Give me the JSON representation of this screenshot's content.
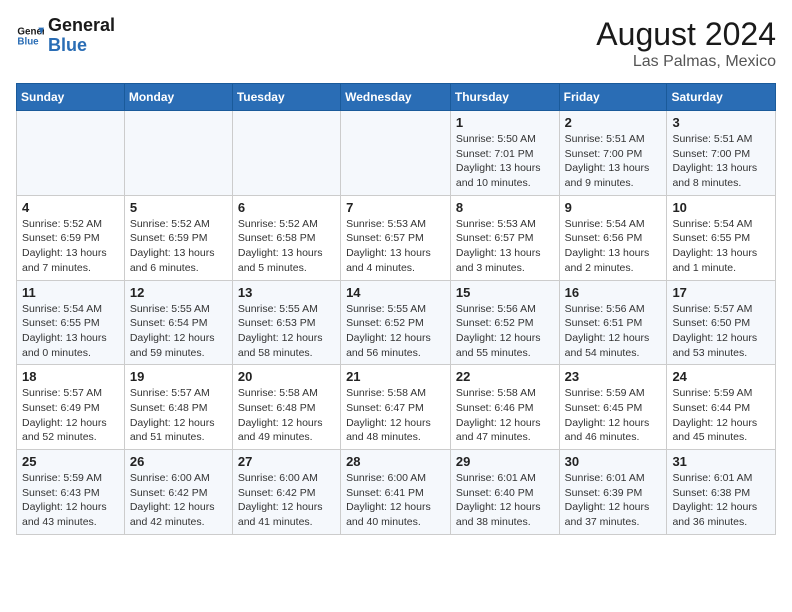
{
  "header": {
    "logo_line1": "General",
    "logo_line2": "Blue",
    "main_title": "August 2024",
    "sub_title": "Las Palmas, Mexico"
  },
  "weekdays": [
    "Sunday",
    "Monday",
    "Tuesday",
    "Wednesday",
    "Thursday",
    "Friday",
    "Saturday"
  ],
  "weeks": [
    [
      {
        "day": "",
        "info": ""
      },
      {
        "day": "",
        "info": ""
      },
      {
        "day": "",
        "info": ""
      },
      {
        "day": "",
        "info": ""
      },
      {
        "day": "1",
        "info": "Sunrise: 5:50 AM\nSunset: 7:01 PM\nDaylight: 13 hours and 10 minutes."
      },
      {
        "day": "2",
        "info": "Sunrise: 5:51 AM\nSunset: 7:00 PM\nDaylight: 13 hours and 9 minutes."
      },
      {
        "day": "3",
        "info": "Sunrise: 5:51 AM\nSunset: 7:00 PM\nDaylight: 13 hours and 8 minutes."
      }
    ],
    [
      {
        "day": "4",
        "info": "Sunrise: 5:52 AM\nSunset: 6:59 PM\nDaylight: 13 hours and 7 minutes."
      },
      {
        "day": "5",
        "info": "Sunrise: 5:52 AM\nSunset: 6:59 PM\nDaylight: 13 hours and 6 minutes."
      },
      {
        "day": "6",
        "info": "Sunrise: 5:52 AM\nSunset: 6:58 PM\nDaylight: 13 hours and 5 minutes."
      },
      {
        "day": "7",
        "info": "Sunrise: 5:53 AM\nSunset: 6:57 PM\nDaylight: 13 hours and 4 minutes."
      },
      {
        "day": "8",
        "info": "Sunrise: 5:53 AM\nSunset: 6:57 PM\nDaylight: 13 hours and 3 minutes."
      },
      {
        "day": "9",
        "info": "Sunrise: 5:54 AM\nSunset: 6:56 PM\nDaylight: 13 hours and 2 minutes."
      },
      {
        "day": "10",
        "info": "Sunrise: 5:54 AM\nSunset: 6:55 PM\nDaylight: 13 hours and 1 minute."
      }
    ],
    [
      {
        "day": "11",
        "info": "Sunrise: 5:54 AM\nSunset: 6:55 PM\nDaylight: 13 hours and 0 minutes."
      },
      {
        "day": "12",
        "info": "Sunrise: 5:55 AM\nSunset: 6:54 PM\nDaylight: 12 hours and 59 minutes."
      },
      {
        "day": "13",
        "info": "Sunrise: 5:55 AM\nSunset: 6:53 PM\nDaylight: 12 hours and 58 minutes."
      },
      {
        "day": "14",
        "info": "Sunrise: 5:55 AM\nSunset: 6:52 PM\nDaylight: 12 hours and 56 minutes."
      },
      {
        "day": "15",
        "info": "Sunrise: 5:56 AM\nSunset: 6:52 PM\nDaylight: 12 hours and 55 minutes."
      },
      {
        "day": "16",
        "info": "Sunrise: 5:56 AM\nSunset: 6:51 PM\nDaylight: 12 hours and 54 minutes."
      },
      {
        "day": "17",
        "info": "Sunrise: 5:57 AM\nSunset: 6:50 PM\nDaylight: 12 hours and 53 minutes."
      }
    ],
    [
      {
        "day": "18",
        "info": "Sunrise: 5:57 AM\nSunset: 6:49 PM\nDaylight: 12 hours and 52 minutes."
      },
      {
        "day": "19",
        "info": "Sunrise: 5:57 AM\nSunset: 6:48 PM\nDaylight: 12 hours and 51 minutes."
      },
      {
        "day": "20",
        "info": "Sunrise: 5:58 AM\nSunset: 6:48 PM\nDaylight: 12 hours and 49 minutes."
      },
      {
        "day": "21",
        "info": "Sunrise: 5:58 AM\nSunset: 6:47 PM\nDaylight: 12 hours and 48 minutes."
      },
      {
        "day": "22",
        "info": "Sunrise: 5:58 AM\nSunset: 6:46 PM\nDaylight: 12 hours and 47 minutes."
      },
      {
        "day": "23",
        "info": "Sunrise: 5:59 AM\nSunset: 6:45 PM\nDaylight: 12 hours and 46 minutes."
      },
      {
        "day": "24",
        "info": "Sunrise: 5:59 AM\nSunset: 6:44 PM\nDaylight: 12 hours and 45 minutes."
      }
    ],
    [
      {
        "day": "25",
        "info": "Sunrise: 5:59 AM\nSunset: 6:43 PM\nDaylight: 12 hours and 43 minutes."
      },
      {
        "day": "26",
        "info": "Sunrise: 6:00 AM\nSunset: 6:42 PM\nDaylight: 12 hours and 42 minutes."
      },
      {
        "day": "27",
        "info": "Sunrise: 6:00 AM\nSunset: 6:42 PM\nDaylight: 12 hours and 41 minutes."
      },
      {
        "day": "28",
        "info": "Sunrise: 6:00 AM\nSunset: 6:41 PM\nDaylight: 12 hours and 40 minutes."
      },
      {
        "day": "29",
        "info": "Sunrise: 6:01 AM\nSunset: 6:40 PM\nDaylight: 12 hours and 38 minutes."
      },
      {
        "day": "30",
        "info": "Sunrise: 6:01 AM\nSunset: 6:39 PM\nDaylight: 12 hours and 37 minutes."
      },
      {
        "day": "31",
        "info": "Sunrise: 6:01 AM\nSunset: 6:38 PM\nDaylight: 12 hours and 36 minutes."
      }
    ]
  ]
}
